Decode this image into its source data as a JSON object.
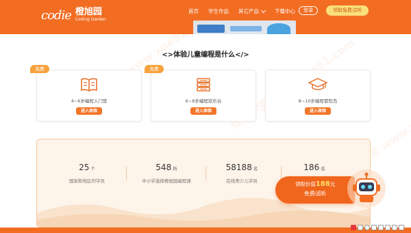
{
  "header": {
    "logo_mark": "codie",
    "logo_name": "橙旭园",
    "logo_sub": "Coding Garden",
    "nav": [
      "首页",
      "学生作品",
      "其它产品",
      "下载中心"
    ],
    "login_label": "登录",
    "trial_label": "领取免费试听"
  },
  "section": {
    "title": "<>体验儿童编程是什么</>"
  },
  "cards": [
    {
      "badge": "免费",
      "icon": "book-icon",
      "label": "4~6岁编程入门营",
      "button": "进入体验"
    },
    {
      "badge": "免费",
      "icon": "books-stack-icon",
      "label": "6~8岁编程欢乐谷",
      "button": "进入体验"
    },
    {
      "badge": "",
      "icon": "graduation-cap-icon",
      "label": "8~10岁编程冒险岛",
      "button": "进入体验"
    }
  ],
  "stats": [
    {
      "number": "25",
      "unit": "个",
      "label": "国家和地区的学员"
    },
    {
      "number": "548",
      "unit": "所",
      "label": "中小学选择橙旭园编程课"
    },
    {
      "number": "58188",
      "unit": "名",
      "label": "在线青少儿学员"
    },
    {
      "number": "186",
      "unit": "名",
      "label": ""
    }
  ],
  "float_cta": {
    "line1_prefix": "领取价值",
    "line1_amount": "188",
    "line1_suffix": "元",
    "line2": "免费试听"
  },
  "watermark": "软件学堂 www.xue51.com",
  "colors": {
    "brand_orange": "#f26d22",
    "accent_yellow": "#fbe07a",
    "badge_orange": "#f7a23e"
  }
}
